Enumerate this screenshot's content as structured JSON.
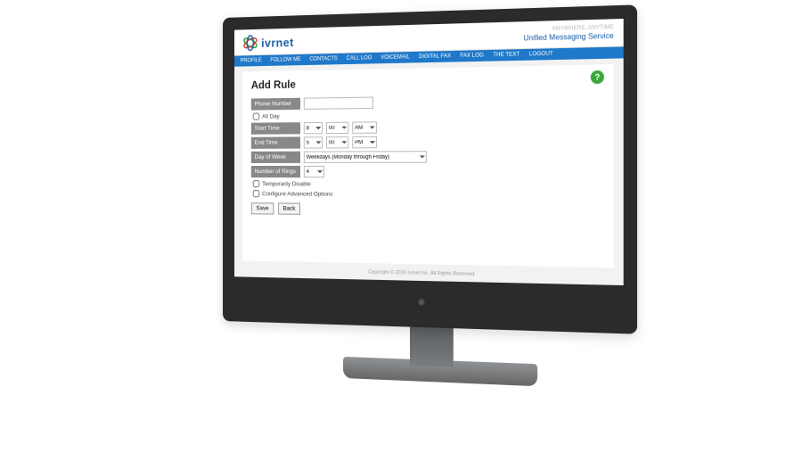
{
  "brand": {
    "name": "ivrnet",
    "tag1": "ANYWHERE, ANYTIME",
    "tag2": "Unified Messaging Service"
  },
  "nav": {
    "items": [
      "PROFILE",
      "FOLLOW ME",
      "CONTACTS",
      "CALL LOG",
      "VOICEMAIL",
      "DIGITAL FAX",
      "FAX LOG",
      "THE TEXT",
      "LOGOUT"
    ]
  },
  "page": {
    "title": "Add Rule"
  },
  "form": {
    "phone": {
      "label": "Phone Number",
      "value": ""
    },
    "allday": {
      "label": "All Day"
    },
    "start": {
      "label": "Start Time",
      "hour": "8",
      "min": "00",
      "ampm": "AM"
    },
    "end": {
      "label": "End Time",
      "hour": "5",
      "min": "00",
      "ampm": "PM"
    },
    "dow": {
      "label": "Day of Week",
      "value": "Weekdays (Monday through Friday)"
    },
    "rings": {
      "label": "Number of Rings",
      "value": "4"
    },
    "tempdisable": {
      "label": "Temporarily Disable"
    },
    "advanced": {
      "label": "Configure Advanced Options"
    },
    "save": "Save",
    "back": "Back"
  },
  "footer": "Copyright © 2016 Ivrnet Inc. All Rights Reserved."
}
